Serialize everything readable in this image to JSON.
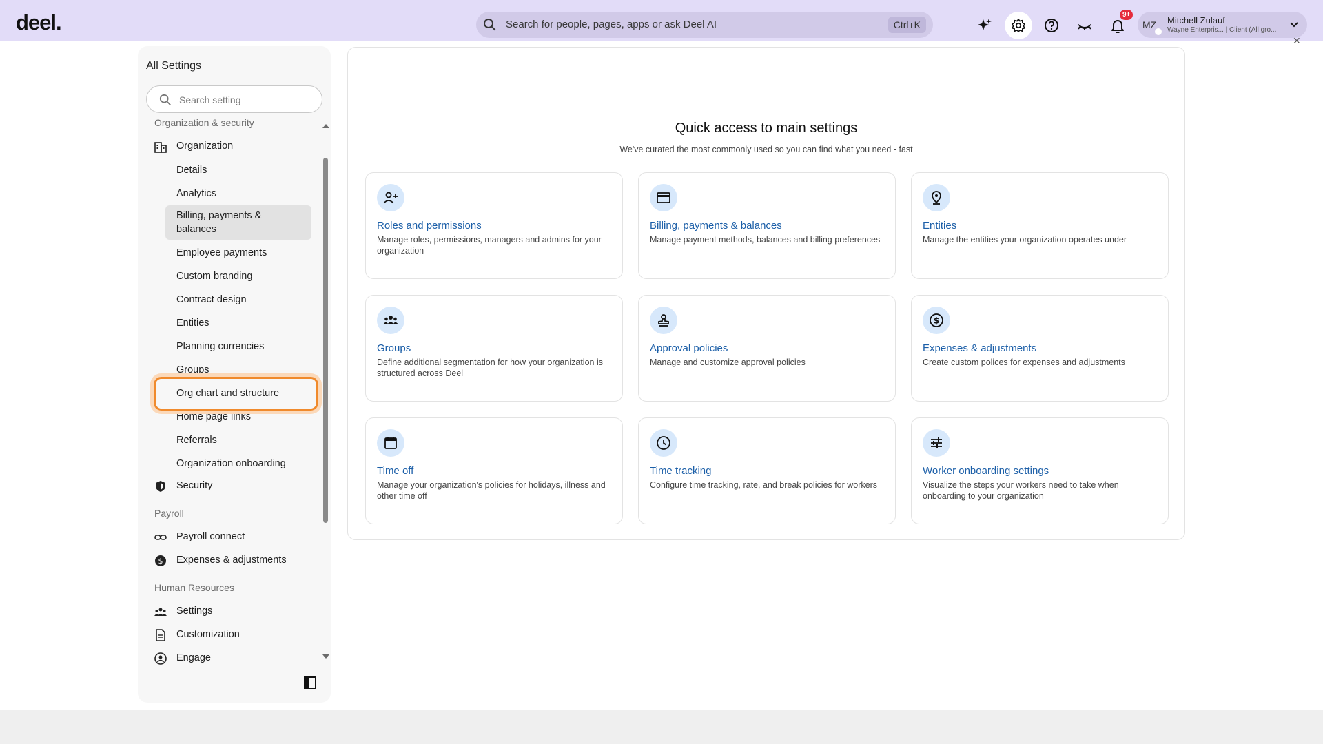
{
  "header": {
    "logo": "deel.",
    "search_placeholder": "Search for people, pages, apps or ask Deel AI",
    "search_shortcut": "Ctrl+K",
    "notifications_badge": "9+",
    "user": {
      "initials": "MZ",
      "name": "Mitchell Zulauf",
      "subtitle": "Wayne Enterpris... | Client (All gro..."
    }
  },
  "sidebar": {
    "title": "All Settings",
    "search_placeholder": "Search setting",
    "section_org": "Organization & security",
    "organization_label": "Organization",
    "org_items": [
      "Details",
      "Analytics",
      "Billing, payments & balances",
      "Employee payments",
      "Custom branding",
      "Contract design",
      "Entities",
      "Planning currencies",
      "Groups",
      "Org chart and structure",
      "Home page links",
      "Referrals",
      "Organization onboarding"
    ],
    "security_label": "Security",
    "section_payroll": "Payroll",
    "payroll_items": [
      "Payroll connect",
      "Expenses & adjustments"
    ],
    "section_hr": "Human Resources",
    "hr_items": [
      "Settings",
      "Customization",
      "Engage"
    ]
  },
  "main": {
    "title": "Quick access to main settings",
    "subtitle": "We've curated the most commonly used so you can find what you need - fast",
    "tiles": [
      {
        "icon": "roles-icon",
        "title": "Roles and permissions",
        "desc": "Manage roles, permissions, managers and admins for your organization"
      },
      {
        "icon": "card-icon",
        "title": "Billing, payments & balances",
        "desc": "Manage payment methods, balances and billing preferences"
      },
      {
        "icon": "location-pin-icon",
        "title": "Entities",
        "desc": "Manage the entities your organization operates under"
      },
      {
        "icon": "groups-icon",
        "title": "Groups",
        "desc": "Define additional segmentation for how your organization is structured across Deel"
      },
      {
        "icon": "stamp-icon",
        "title": "Approval policies",
        "desc": "Manage and customize approval policies"
      },
      {
        "icon": "dollar-circle-icon",
        "title": "Expenses & adjustments",
        "desc": "Create custom polices for expenses and adjustments"
      },
      {
        "icon": "calendar-icon",
        "title": "Time off",
        "desc": "Manage your organization's policies for holidays, illness and other time off"
      },
      {
        "icon": "clock-icon",
        "title": "Time tracking",
        "desc": "Configure time tracking, rate, and break policies for workers"
      },
      {
        "icon": "sliders-icon",
        "title": "Worker onboarding settings",
        "desc": "Visualize the steps your workers need to take when onboarding to your organization"
      }
    ]
  }
}
